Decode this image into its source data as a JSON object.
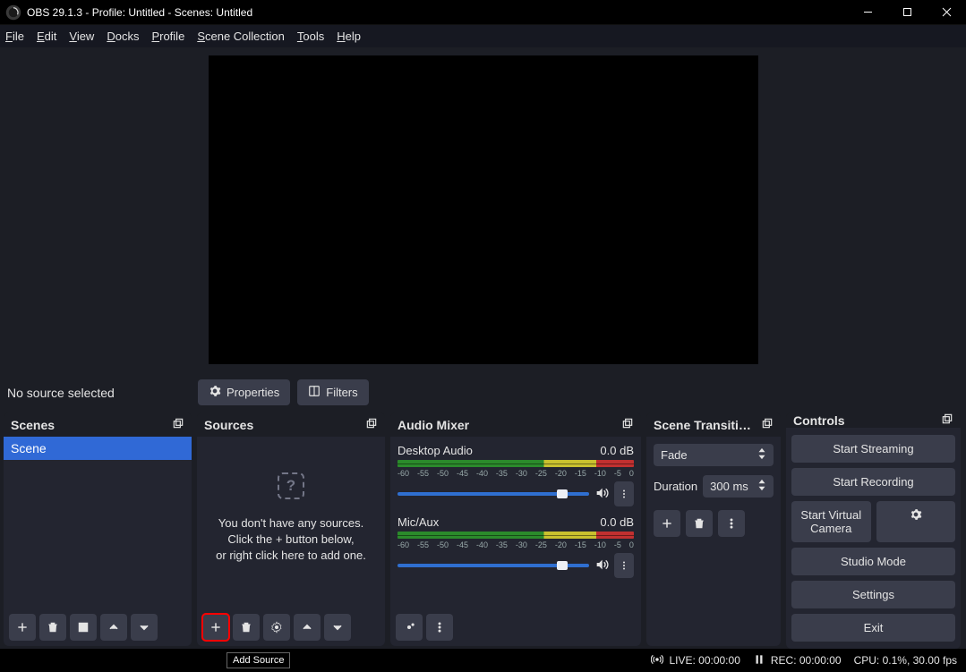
{
  "titlebar": {
    "text": "OBS 29.1.3 - Profile: Untitled - Scenes: Untitled"
  },
  "menu": {
    "file": "File",
    "edit": "Edit",
    "view": "View",
    "docks": "Docks",
    "profile": "Profile",
    "scene_collection": "Scene Collection",
    "tools": "Tools",
    "help": "Help"
  },
  "toolbar": {
    "no_source": "No source selected",
    "properties": "Properties",
    "filters": "Filters"
  },
  "scenes": {
    "title": "Scenes",
    "items": [
      "Scene"
    ]
  },
  "sources": {
    "title": "Sources",
    "empty_line1": "You don't have any sources.",
    "empty_line2": "Click the + button below,",
    "empty_line3": "or right click here to add one.",
    "tooltip": "Add Source"
  },
  "mixer": {
    "title": "Audio Mixer",
    "ticks": [
      "-60",
      "-55",
      "-50",
      "-45",
      "-40",
      "-35",
      "-30",
      "-25",
      "-20",
      "-15",
      "-10",
      "-5",
      "0"
    ],
    "channels": [
      {
        "name": "Desktop Audio",
        "db": "0.0 dB",
        "thumb_pct": 83
      },
      {
        "name": "Mic/Aux",
        "db": "0.0 dB",
        "thumb_pct": 83
      }
    ]
  },
  "transitions": {
    "title": "Scene Transiti…",
    "selected": "Fade",
    "duration_label": "Duration",
    "duration_value": "300 ms"
  },
  "controls": {
    "title": "Controls",
    "start_streaming": "Start Streaming",
    "start_recording": "Start Recording",
    "start_virtual_camera": "Start Virtual Camera",
    "studio_mode": "Studio Mode",
    "settings": "Settings",
    "exit": "Exit"
  },
  "status": {
    "live": "LIVE: 00:00:00",
    "rec": "REC: 00:00:00",
    "cpu": "CPU: 0.1%, 30.00 fps"
  }
}
